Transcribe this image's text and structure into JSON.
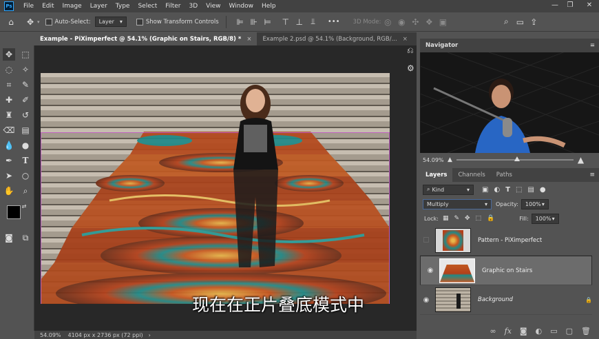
{
  "menu": {
    "logo": "Ps",
    "items": [
      "File",
      "Edit",
      "Image",
      "Layer",
      "Type",
      "Select",
      "Filter",
      "3D",
      "View",
      "Window",
      "Help"
    ]
  },
  "window_controls": {
    "minimize": "—",
    "restore": "❐",
    "close": "✕"
  },
  "options": {
    "auto_select_label": "Auto-Select:",
    "auto_select_value": "Layer",
    "transform_label": "Show Transform Controls",
    "mode_label": "3D Mode:",
    "more": "•••"
  },
  "tabs": [
    {
      "label": "Example - PiXimperfect @ 54.1% (Graphic on Stairs, RGB/8) *",
      "close": "×"
    },
    {
      "label": "Example 2.psd @ 54.1% (Background, RGB/...",
      "close": "×"
    }
  ],
  "caption": "现在在正片叠底模式中",
  "status": {
    "zoom": "54.09%",
    "doc": "4104 px x 2736 px (72 ppi)",
    "arrow": "›"
  },
  "navigator": {
    "title": "Navigator",
    "zoom": "54.09%"
  },
  "layers_panel": {
    "tabs": [
      "Layers",
      "Channels",
      "Paths"
    ],
    "filter": "Kind",
    "blend_mode": "Multiply",
    "opacity_label": "Opacity:",
    "opacity": "100%",
    "lock_label": "Lock:",
    "fill_label": "Fill:",
    "fill": "100%",
    "layers": [
      {
        "name": "Pattern - PiXimperfect",
        "visible": false
      },
      {
        "name": "Graphic on Stairs",
        "visible": true
      },
      {
        "name": "Background",
        "visible": true
      }
    ],
    "footer": [
      "∞",
      "fx",
      "◙",
      "◐",
      "▭",
      "▢",
      "🗑"
    ]
  },
  "colors": {
    "accent": "#31a8ff",
    "pattern_orange": "#c8561e",
    "pattern_teal": "#1f8a88"
  }
}
